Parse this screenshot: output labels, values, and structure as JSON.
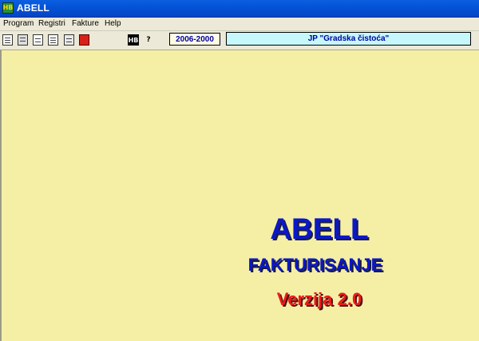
{
  "window": {
    "title": "ABELL",
    "icon": "abell-app-icon"
  },
  "menu": [
    {
      "label": "Program"
    },
    {
      "label": "Registri"
    },
    {
      "label": "Fakture"
    },
    {
      "label": "Help"
    }
  ],
  "toolbar": {
    "buttons": [
      {
        "icon": "open-book-icon"
      },
      {
        "icon": "calculator-icon"
      },
      {
        "icon": "document-icon"
      },
      {
        "icon": "list-document-icon"
      },
      {
        "icon": "report-icon"
      },
      {
        "icon": "exit-icon"
      }
    ],
    "hb_label": "HB",
    "help_label": "?",
    "year_range": "2006-2000",
    "company": "JP \"Gradska čistoća\""
  },
  "splash": {
    "title": "ABELL",
    "subtitle": "FAKTURISANJE",
    "version": "Verzija 2.0"
  },
  "colors": {
    "titlebar": "#0552d6",
    "workspace": "#f5efa6",
    "splash_blue": "#0a18c8",
    "splash_red": "#ee1a1a",
    "company_box": "#c6f7fb"
  }
}
